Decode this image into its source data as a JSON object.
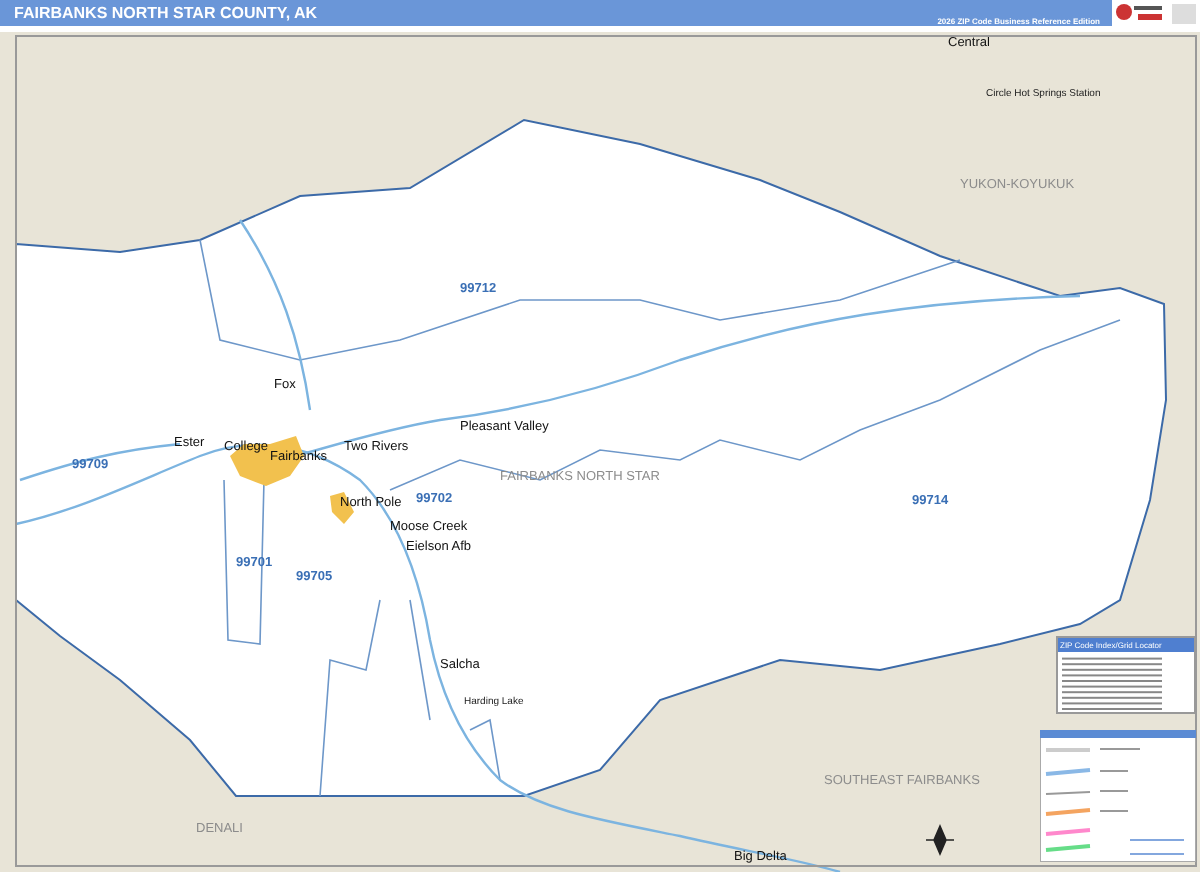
{
  "header": {
    "title": "FAIRBANKS NORTH STAR COUNTY, AK",
    "edition": "2026 ZIP Code Business Reference Edition"
  },
  "places": [
    {
      "name": "Central",
      "kind": "city"
    },
    {
      "name": "Circle Hot Springs Station",
      "kind": "small"
    },
    {
      "name": "YUKON-KOYUKUK",
      "kind": "region"
    },
    {
      "name": "99712",
      "kind": "zip"
    },
    {
      "name": "Fox",
      "kind": "city"
    },
    {
      "name": "Ester",
      "kind": "city"
    },
    {
      "name": "College",
      "kind": "city"
    },
    {
      "name": "Fairbanks",
      "kind": "city"
    },
    {
      "name": "Two Rivers",
      "kind": "city"
    },
    {
      "name": "Pleasant Valley",
      "kind": "city"
    },
    {
      "name": "FAIRBANKS NORTH STAR",
      "kind": "region"
    },
    {
      "name": "99709",
      "kind": "zip"
    },
    {
      "name": "North Pole",
      "kind": "city"
    },
    {
      "name": "99702",
      "kind": "zip"
    },
    {
      "name": "Moose Creek",
      "kind": "city"
    },
    {
      "name": "Eielson Afb",
      "kind": "city"
    },
    {
      "name": "99701",
      "kind": "zip"
    },
    {
      "name": "99705",
      "kind": "zip"
    },
    {
      "name": "99714",
      "kind": "zip"
    },
    {
      "name": "Salcha",
      "kind": "city"
    },
    {
      "name": "Harding Lake",
      "kind": "small"
    },
    {
      "name": "SOUTHEAST FAIRBANKS",
      "kind": "region"
    },
    {
      "name": "DENALI",
      "kind": "region"
    },
    {
      "name": "Big Delta",
      "kind": "city"
    }
  ],
  "zip_index": {
    "title": "ZIP Code Index/Grid Locator"
  }
}
